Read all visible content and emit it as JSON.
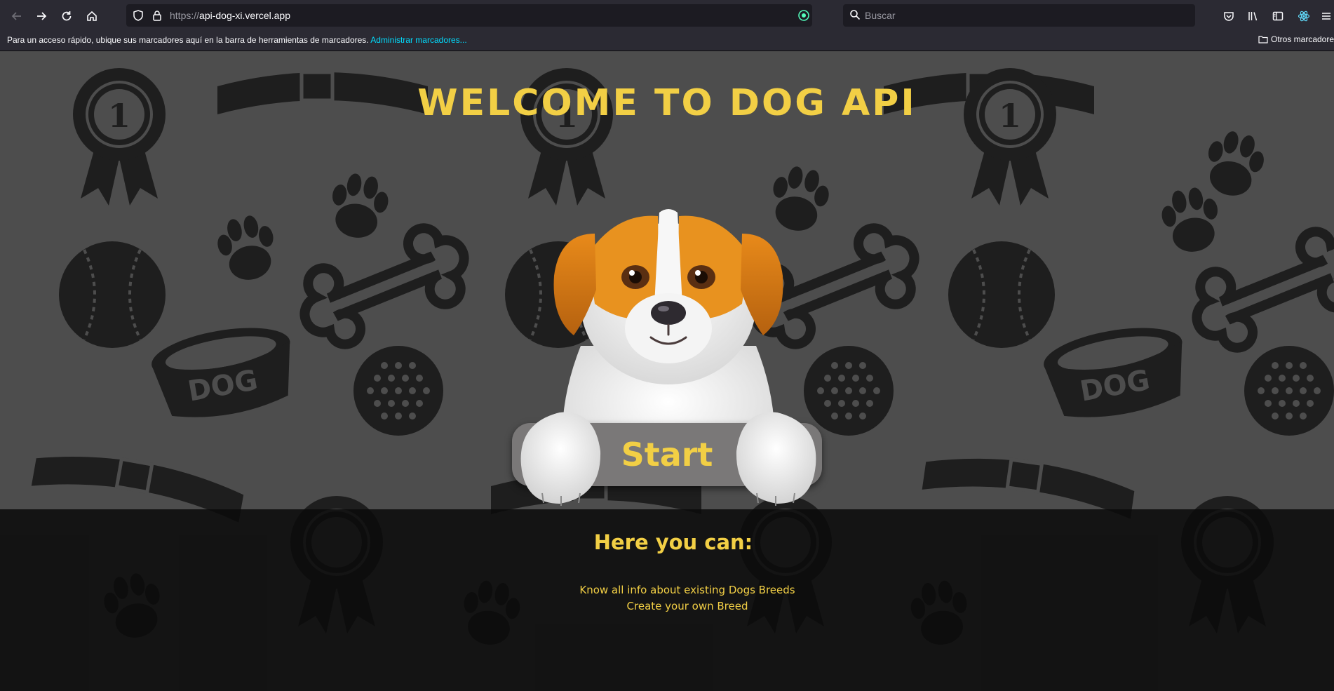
{
  "browser": {
    "url_prefix": "https://",
    "url_host": "api-dog-xi.vercel.app",
    "search_placeholder": "Buscar",
    "bookmarks_hint": "Para un acceso rápido, ubique sus marcadores aquí en la barra de herramientas de marcadores.",
    "bookmarks_manage": "Administrar marcadores...",
    "other_bookmarks": "Otros marcadores"
  },
  "landing": {
    "title": "WELCOME TO DOG API",
    "start_label": "Start",
    "bowl_label": "DOG",
    "badge_number": "1",
    "info_heading": "Here you can:",
    "info_items": [
      "Know all info about existing Dogs Breeds",
      "Create your own Breed"
    ]
  },
  "colors": {
    "accent": "#f2cf45",
    "page_background": "#4d4d4d",
    "pattern_shapes": "#1e1e1e",
    "info_panel": "#0a0a0a",
    "chrome": "#2b2a33"
  }
}
